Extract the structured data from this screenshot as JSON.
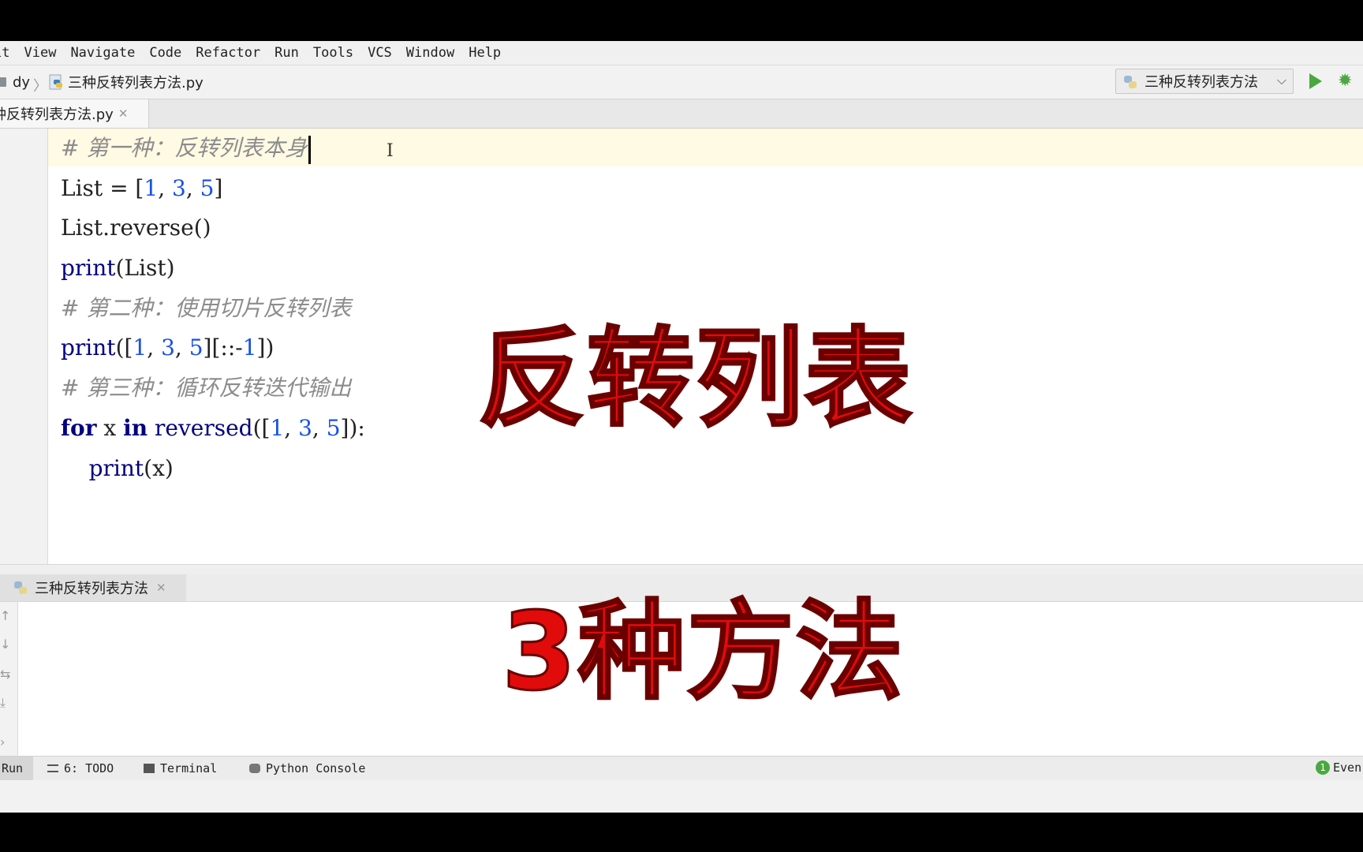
{
  "menubar": {
    "items": [
      "it",
      "View",
      "Navigate",
      "Code",
      "Refactor",
      "Run",
      "Tools",
      "VCS",
      "Window",
      "Help"
    ]
  },
  "navbar": {
    "project": "dy",
    "file": "三种反转列表方法.py",
    "run_config": "三种反转列表方法"
  },
  "tabs": [
    {
      "label": "种反转列表方法.py"
    }
  ],
  "editor": {
    "lines": [
      "# 第一种：反转列表本身",
      "List = [1, 3, 5]",
      "List.reverse()",
      "print(List)",
      "# 第二种：使用切片反转列表",
      "print([1, 3, 5][::-1])",
      "# 第三种：循环反转迭代输出",
      "for x in reversed([1, 3, 5]):",
      "    print(x)"
    ]
  },
  "overlay": {
    "title": "反转列表",
    "subtitle": "3种方法"
  },
  "run_panel": {
    "tab_label": "三种反转列表方法"
  },
  "statusbar": {
    "run": "Run",
    "todo": "6: TODO",
    "terminal": "Terminal",
    "python_console": "Python Console",
    "events": "Even",
    "events_badge": "1"
  },
  "colors": {
    "run_green": "#4aa83e",
    "overlay_red": "#e10b0b",
    "comment_gray": "#8c8c8c",
    "number_blue": "#1750eb",
    "keyword_navy": "#000080"
  }
}
